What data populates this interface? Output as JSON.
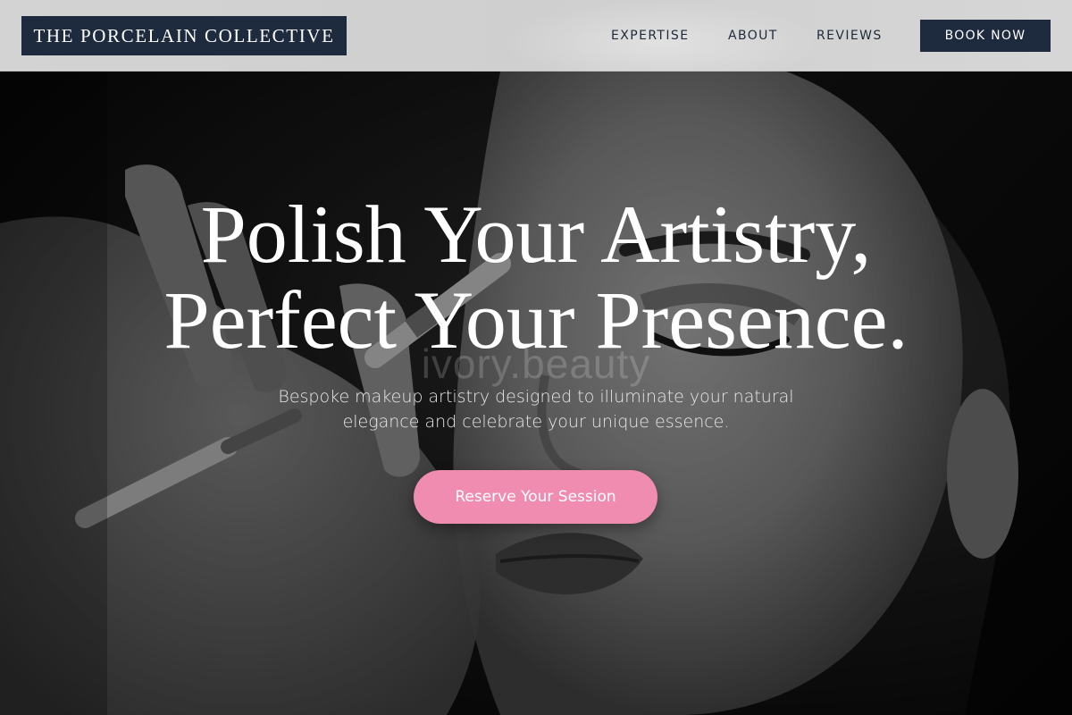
{
  "header": {
    "logo_text": "THE PORCELAIN COLLECTIVE",
    "nav": [
      {
        "label": "EXPERTISE"
      },
      {
        "label": "ABOUT"
      },
      {
        "label": "REVIEWS"
      }
    ],
    "book_label": "BOOK NOW"
  },
  "hero": {
    "headline_line1": "Polish Your Artistry,",
    "headline_line2": "Perfect Your Presence.",
    "watermark": "ivory.beauty",
    "subtext_line1": "Bespoke makeup artistry designed to illuminate your natural",
    "subtext_line2": "elegance and celebrate your unique essence.",
    "cta_label": "Reserve Your Session"
  },
  "colors": {
    "navy": "#1e2a3e",
    "header_bg": "#d3d3d3",
    "accent_pink": "#f08cb0",
    "headline": "#ffffff"
  }
}
